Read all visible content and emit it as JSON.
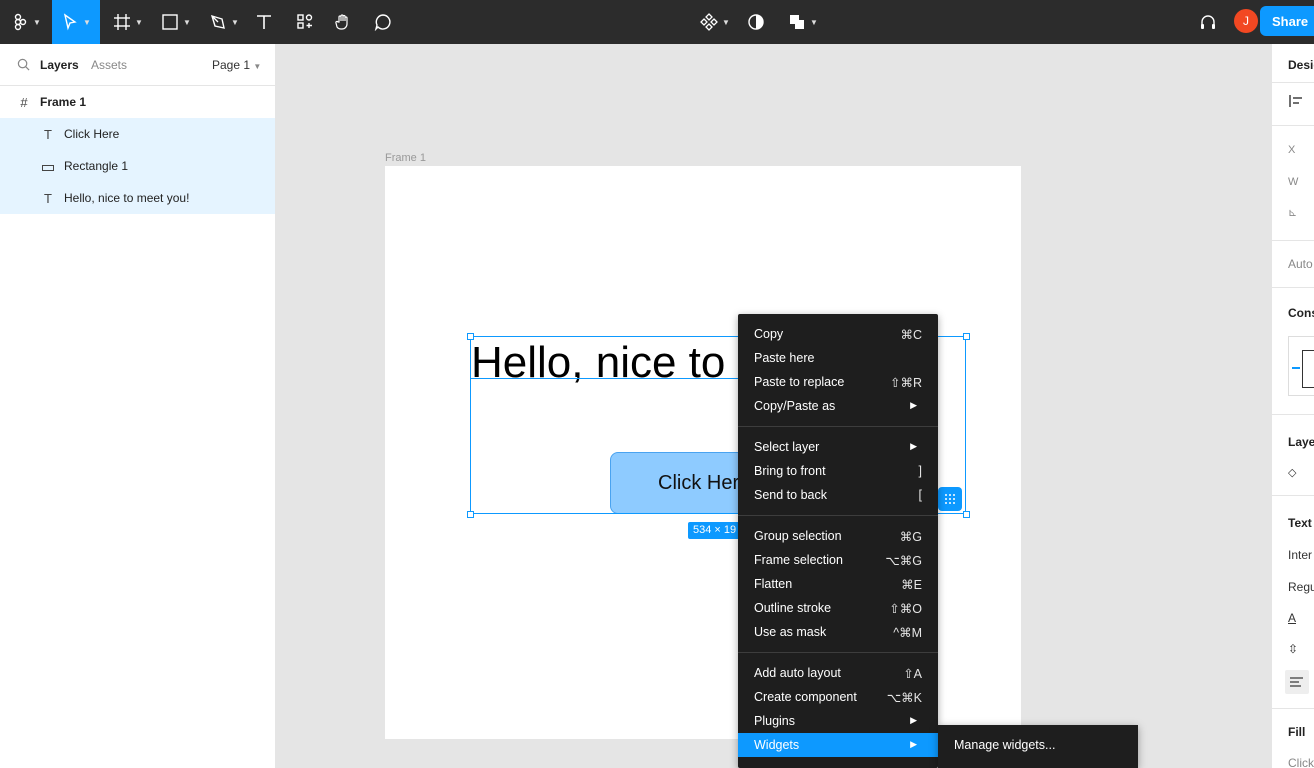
{
  "toolbar": {
    "share_label": "Share",
    "avatar_initial": "J",
    "accent": "#0d99ff",
    "icons": [
      "figma-menu-icon",
      "move-tool-icon",
      "frame-tool-icon",
      "shape-tool-icon",
      "pen-tool-icon",
      "text-tool-icon",
      "resources-icon",
      "hand-tool-icon",
      "comment-icon",
      "components-icon",
      "contrast-icon",
      "boolean-ops-icon",
      "headphones-icon"
    ]
  },
  "left_panel": {
    "tabs": {
      "layers": "Layers",
      "assets": "Assets",
      "page": "Page 1"
    },
    "layers": [
      {
        "label": "Frame 1",
        "icon": "frame-icon",
        "selected": false
      },
      {
        "label": "Click Here",
        "icon": "text-layer-icon",
        "selected": true
      },
      {
        "label": "Rectangle 1",
        "icon": "rectangle-layer-icon",
        "selected": true
      },
      {
        "label": "Hello, nice to meet you!",
        "icon": "text-layer-icon",
        "selected": true
      }
    ]
  },
  "canvas": {
    "frame_label": "Frame 1",
    "hello_text": "Hello, nice to meet you!",
    "button_text": "Click Here",
    "dimensions_badge": "534 × 19"
  },
  "context_menu": {
    "items": [
      {
        "label": "Copy",
        "shortcut": "⌘C"
      },
      {
        "label": "Paste here",
        "shortcut": ""
      },
      {
        "label": "Paste to replace",
        "shortcut": "⇧⌘R"
      },
      {
        "label": "Copy/Paste as",
        "shortcut": "",
        "submenu": true
      },
      {
        "label": "Select layer",
        "shortcut": "",
        "submenu": true
      },
      {
        "label": "Bring to front",
        "shortcut": "]"
      },
      {
        "label": "Send to back",
        "shortcut": "["
      },
      {
        "label": "Group selection",
        "shortcut": "⌘G"
      },
      {
        "label": "Frame selection",
        "shortcut": "⌥⌘G"
      },
      {
        "label": "Flatten",
        "shortcut": "⌘E"
      },
      {
        "label": "Outline stroke",
        "shortcut": "⇧⌘O"
      },
      {
        "label": "Use as mask",
        "shortcut": "^⌘M"
      },
      {
        "label": "Add auto layout",
        "shortcut": "⇧A"
      },
      {
        "label": "Create component",
        "shortcut": "⌥⌘K"
      },
      {
        "label": "Plugins",
        "shortcut": "",
        "submenu": true
      },
      {
        "label": "Widgets",
        "shortcut": "",
        "submenu": true,
        "highlighted": true
      }
    ],
    "submenu": {
      "label": "Manage widgets..."
    }
  },
  "right_panel": {
    "design": "Desig",
    "x": "X",
    "w": "W",
    "auto": "Auto",
    "cons": "Cons",
    "layer": "Laye",
    "text": "Text",
    "font": "Inter",
    "weight": "Regu",
    "fill": "Fill",
    "fill_sub": "Click"
  }
}
